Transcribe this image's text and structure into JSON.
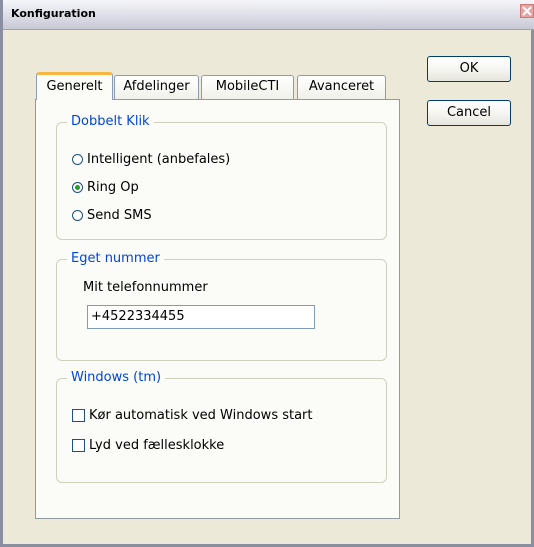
{
  "window": {
    "title": "Konfiguration"
  },
  "tabs": [
    {
      "label": "Generelt",
      "active": true
    },
    {
      "label": "Afdelinger",
      "active": false
    },
    {
      "label": "MobileCTI",
      "active": false
    },
    {
      "label": "Avanceret",
      "active": false
    }
  ],
  "dobbelt_klik": {
    "legend": "Dobbelt Klik",
    "options": [
      {
        "label": "Intelligent (anbefales)",
        "selected": false
      },
      {
        "label": "Ring Op",
        "selected": true
      },
      {
        "label": "Send SMS",
        "selected": false
      }
    ]
  },
  "eget_nummer": {
    "legend": "Eget nummer",
    "field_label": "Mit telefonnummer",
    "phone_value": "+4522334455"
  },
  "windows": {
    "legend": "Windows (tm)",
    "options": [
      {
        "label": "Kør automatisk ved Windows start",
        "checked": false
      },
      {
        "label": "Lyd ved fællesklokke",
        "checked": false
      }
    ]
  },
  "buttons": {
    "ok": "OK",
    "cancel": "Cancel"
  },
  "colors": {
    "accent_tab": "#f7b642",
    "legend_text": "#0046d5",
    "radio_selected": "#21a121",
    "dialog_bg": "#ECE9D8"
  }
}
